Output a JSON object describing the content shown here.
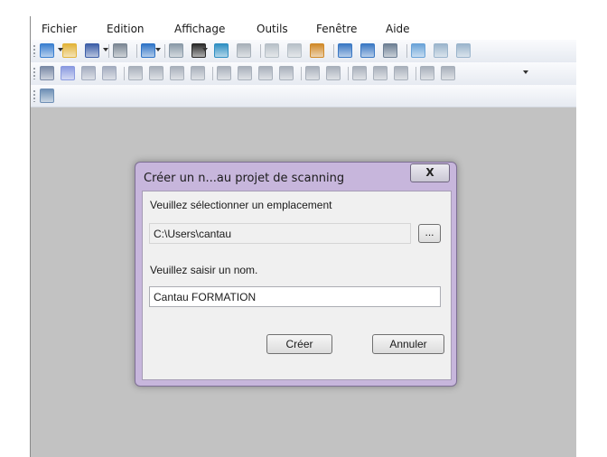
{
  "menu": [
    "Fichier",
    "Edition",
    "Affichage",
    "Outils",
    "Fenêtre",
    "Aide"
  ],
  "toolbars": {
    "row1": [
      {
        "icon": "new-document-icon",
        "color": "#3a7fd0"
      },
      {
        "icon": "open-folder-icon",
        "color": "#e2b43a"
      },
      {
        "icon": "save-icon",
        "color": "#3d5fa8"
      },
      {
        "icon": "print-icon",
        "color": "#7b8794"
      },
      {
        "icon": "help-icon",
        "color": "#2f74c7"
      },
      {
        "icon": "scan-icon",
        "color": "#8a9aa8"
      },
      {
        "icon": "3d-view-icon",
        "color": "#2a2a2a"
      },
      {
        "icon": "home-view-icon",
        "color": "#2f8fc3"
      },
      {
        "icon": "grid-view-icon",
        "color": "#a7b0b9"
      },
      {
        "icon": "panel-icon",
        "color": "#b7c0c8"
      },
      {
        "icon": "zoom-icon",
        "color": "#b7c0c8"
      },
      {
        "icon": "download-icon",
        "color": "#d08a2a"
      },
      {
        "icon": "calendar-icon",
        "color": "#3a78c4"
      },
      {
        "icon": "document-export-icon",
        "color": "#3a78c4"
      },
      {
        "icon": "list-icon",
        "color": "#6d7f94"
      },
      {
        "icon": "cloud-add-icon",
        "color": "#6aa3d8"
      },
      {
        "icon": "cloud-sync-icon",
        "color": "#9bb5cc"
      },
      {
        "icon": "cloud-remove-icon",
        "color": "#9bb5cc"
      }
    ],
    "row2": [
      {
        "icon": "select-arrow-icon",
        "color": "#7a8aa6"
      },
      {
        "icon": "sphere-icon",
        "color": "#8a9ae0"
      },
      {
        "icon": "lasso-icon",
        "color": "#a3acbf"
      },
      {
        "icon": "cloud-points-icon",
        "color": "#a3acbf"
      },
      {
        "icon": "register-icon",
        "color": "#a8b0bb"
      },
      {
        "icon": "align-icon",
        "color": "#a8b0bb"
      },
      {
        "icon": "target-icon",
        "color": "#a8b0bb"
      },
      {
        "icon": "box-icon",
        "color": "#a8b0bb"
      },
      {
        "icon": "box-edit-icon",
        "color": "#a8b0bb"
      },
      {
        "icon": "box-clip-icon",
        "color": "#a8b0bb"
      },
      {
        "icon": "cube-icon",
        "color": "#a8b0bb"
      },
      {
        "icon": "cube-filled-icon",
        "color": "#a8b0bb"
      },
      {
        "icon": "measure-icon",
        "color": "#a8b0bb"
      },
      {
        "icon": "angle-icon",
        "color": "#a8b0bb"
      },
      {
        "icon": "plane-icon",
        "color": "#a8b0bb"
      },
      {
        "icon": "section-icon",
        "color": "#a8b0bb"
      },
      {
        "icon": "mesh-icon",
        "color": "#a8b0bb"
      },
      {
        "icon": "export-icon",
        "color": "#a8b0bb"
      },
      {
        "icon": "table-icon",
        "color": "#a8b0bb"
      }
    ],
    "row3": [
      {
        "icon": "scan-image-icon",
        "color": "#6e8fb5"
      }
    ]
  },
  "dialog": {
    "title": "Créer un n...au projet de scanning",
    "close_label": "X",
    "location_label": "Veuillez sélectionner un emplacement",
    "location_value": "C:\\Users\\cantau",
    "browse_label": "...",
    "name_label": "Veuillez saisir un nom.",
    "name_value": "Cantau FORMATION",
    "create_label": "Créer",
    "cancel_label": "Annuler"
  }
}
